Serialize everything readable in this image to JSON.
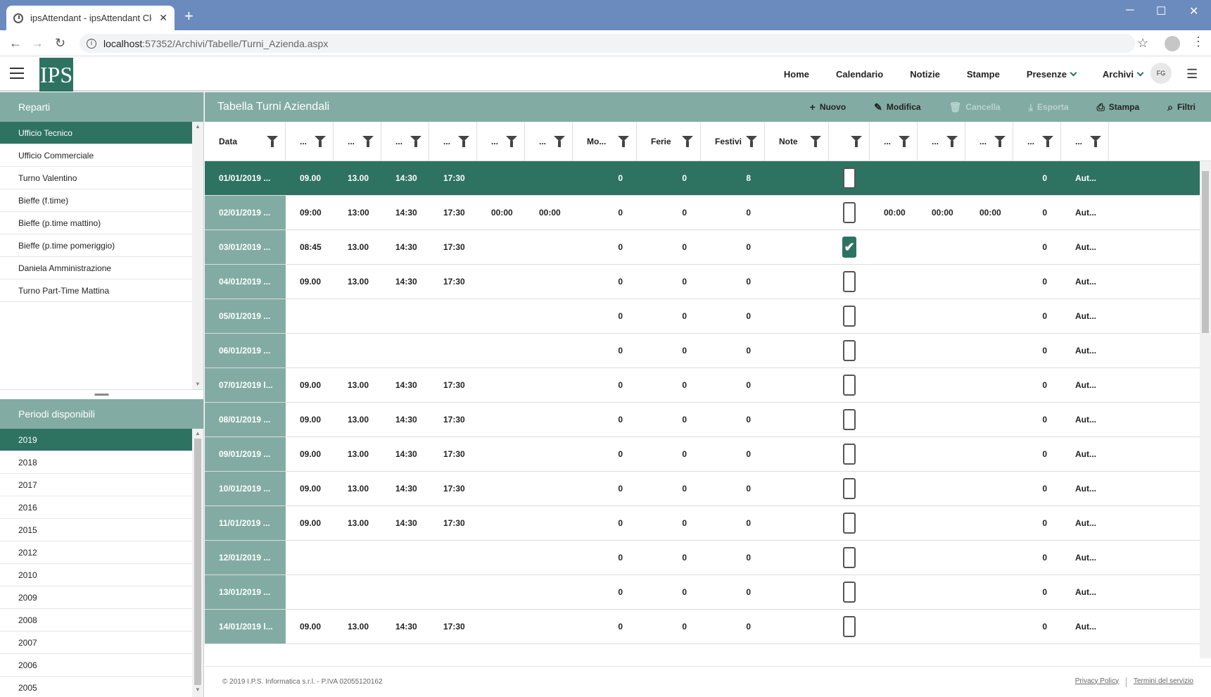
{
  "browser": {
    "tab_title": "ipsAttendant - ipsAttendant Clou",
    "url_host": "localhost",
    "url_path": ":57352/Archivi/Tabelle/Turni_Azienda.aspx"
  },
  "app": {
    "logo_text": "IPS",
    "avatar": "FG",
    "nav": [
      "Home",
      "Calendario",
      "Notizie",
      "Stampe",
      "Presenze",
      "Archivi"
    ]
  },
  "left": {
    "reparti_title": "Reparti",
    "reparti": [
      "Ufficio Tecnico",
      "Ufficio Commerciale",
      "Turno Valentino",
      "Bieffe (f.time)",
      "Bieffe (p.time mattino)",
      "Bieffe (p.time pomeriggio)",
      "Daniela Amministrazione",
      "Turno Part-Time Mattina"
    ],
    "periodi_title": "Periodi disponibili",
    "periodi": [
      "2019",
      "2018",
      "2017",
      "2016",
      "2015",
      "2012",
      "2010",
      "2009",
      "2008",
      "2007",
      "2006",
      "2005"
    ]
  },
  "main": {
    "title": "Tabella Turni Aziendali",
    "toolbar": {
      "nuovo": "Nuovo",
      "modifica": "Modifica",
      "cancella": "Cancella",
      "esporta": "Esporta",
      "stampa": "Stampa",
      "filtri": "Filtri"
    },
    "columns": [
      "Data",
      "...",
      "...",
      "...",
      "...",
      "...",
      "...",
      "Mo...",
      "Ferie",
      "Festivi",
      "Note",
      "",
      "...",
      "...",
      "...",
      "...",
      "..."
    ],
    "rows": [
      {
        "data": "01/01/2019 ...",
        "t": [
          "09.00",
          "13.00",
          "14:30",
          "17:30",
          "",
          ""
        ],
        "mo": "0",
        "ferie": "0",
        "festivi": "8",
        "note": "",
        "chk": false,
        "x": [
          "",
          "",
          ""
        ],
        "n": "0",
        "aut": "Aut...",
        "sel": true
      },
      {
        "data": "02/01/2019 ...",
        "t": [
          "09:00",
          "13:00",
          "14:30",
          "17:30",
          "00:00",
          "00:00"
        ],
        "mo": "0",
        "ferie": "0",
        "festivi": "0",
        "note": "",
        "chk": false,
        "x": [
          "00:00",
          "00:00",
          "00:00"
        ],
        "n": "0",
        "aut": "Aut..."
      },
      {
        "data": "03/01/2019 ...",
        "t": [
          "08:45",
          "13.00",
          "14:30",
          "17:30",
          "",
          ""
        ],
        "mo": "0",
        "ferie": "0",
        "festivi": "0",
        "note": "",
        "chk": true,
        "x": [
          "",
          "",
          ""
        ],
        "n": "0",
        "aut": "Aut..."
      },
      {
        "data": "04/01/2019 ...",
        "t": [
          "09.00",
          "13.00",
          "14:30",
          "17:30",
          "",
          ""
        ],
        "mo": "0",
        "ferie": "0",
        "festivi": "0",
        "note": "",
        "chk": false,
        "x": [
          "",
          "",
          ""
        ],
        "n": "0",
        "aut": "Aut..."
      },
      {
        "data": "05/01/2019 ...",
        "t": [
          "",
          "",
          "",
          "",
          "",
          ""
        ],
        "mo": "0",
        "ferie": "0",
        "festivi": "0",
        "note": "",
        "chk": false,
        "x": [
          "",
          "",
          ""
        ],
        "n": "0",
        "aut": "Aut..."
      },
      {
        "data": "06/01/2019 ...",
        "t": [
          "",
          "",
          "",
          "",
          "",
          ""
        ],
        "mo": "0",
        "ferie": "0",
        "festivi": "0",
        "note": "",
        "chk": false,
        "x": [
          "",
          "",
          ""
        ],
        "n": "0",
        "aut": "Aut..."
      },
      {
        "data": "07/01/2019 l...",
        "t": [
          "09.00",
          "13.00",
          "14:30",
          "17:30",
          "",
          ""
        ],
        "mo": "0",
        "ferie": "0",
        "festivi": "0",
        "note": "",
        "chk": false,
        "x": [
          "",
          "",
          ""
        ],
        "n": "0",
        "aut": "Aut..."
      },
      {
        "data": "08/01/2019 ...",
        "t": [
          "09.00",
          "13.00",
          "14:30",
          "17:30",
          "",
          ""
        ],
        "mo": "0",
        "ferie": "0",
        "festivi": "0",
        "note": "",
        "chk": false,
        "x": [
          "",
          "",
          ""
        ],
        "n": "0",
        "aut": "Aut..."
      },
      {
        "data": "09/01/2019 ...",
        "t": [
          "09.00",
          "13.00",
          "14:30",
          "17:30",
          "",
          ""
        ],
        "mo": "0",
        "ferie": "0",
        "festivi": "0",
        "note": "",
        "chk": false,
        "x": [
          "",
          "",
          ""
        ],
        "n": "0",
        "aut": "Aut..."
      },
      {
        "data": "10/01/2019 ...",
        "t": [
          "09.00",
          "13.00",
          "14:30",
          "17:30",
          "",
          ""
        ],
        "mo": "0",
        "ferie": "0",
        "festivi": "0",
        "note": "",
        "chk": false,
        "x": [
          "",
          "",
          ""
        ],
        "n": "0",
        "aut": "Aut..."
      },
      {
        "data": "11/01/2019 ...",
        "t": [
          "09.00",
          "13.00",
          "14:30",
          "17:30",
          "",
          ""
        ],
        "mo": "0",
        "ferie": "0",
        "festivi": "0",
        "note": "",
        "chk": false,
        "x": [
          "",
          "",
          ""
        ],
        "n": "0",
        "aut": "Aut..."
      },
      {
        "data": "12/01/2019 ...",
        "t": [
          "",
          "",
          "",
          "",
          "",
          ""
        ],
        "mo": "0",
        "ferie": "0",
        "festivi": "0",
        "note": "",
        "chk": false,
        "x": [
          "",
          "",
          ""
        ],
        "n": "0",
        "aut": "Aut..."
      },
      {
        "data": "13/01/2019 ...",
        "t": [
          "",
          "",
          "",
          "",
          "",
          ""
        ],
        "mo": "0",
        "ferie": "0",
        "festivi": "0",
        "note": "",
        "chk": false,
        "x": [
          "",
          "",
          ""
        ],
        "n": "0",
        "aut": "Aut..."
      },
      {
        "data": "14/01/2019 l...",
        "t": [
          "09.00",
          "13.00",
          "14:30",
          "17:30",
          "",
          ""
        ],
        "mo": "0",
        "ferie": "0",
        "festivi": "0",
        "note": "",
        "chk": false,
        "x": [
          "",
          "",
          ""
        ],
        "n": "0",
        "aut": "Aut..."
      }
    ],
    "footer": {
      "copyright": "© 2019 I.P.S. Informatica s.r.l. - P.IVA 02055120162",
      "privacy": "Privacy Policy",
      "terms": "Termini del servizio"
    }
  },
  "colors": {
    "accent": "#2e7262",
    "header": "#82aca3",
    "chrome": "#6b8bbf"
  }
}
